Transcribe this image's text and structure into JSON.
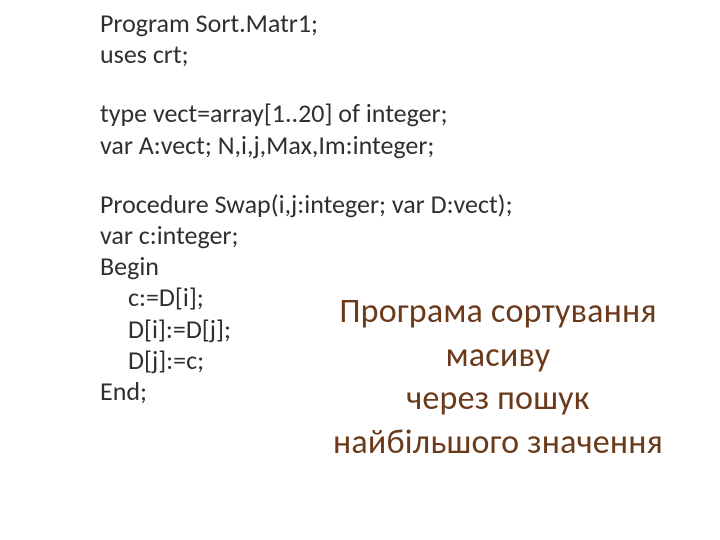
{
  "code": {
    "l1": "Program Sort.Matr1;",
    "l2": "uses crt;",
    "l3": "type vect=array[1..20] of integer;",
    "l4": "var A:vect;  N,i,j,Max,Im:integer;",
    "l5": "Procedure Swap(i,j:integer; var D:vect);",
    "l6": "var c:integer;",
    "l7": "Begin",
    "l8": "c:=D[i];",
    "l9": "D[i]:=D[j];",
    "l10": "D[j]:=c;",
    "l11": "End;"
  },
  "title": {
    "line1": "Програма сортування",
    "line2": "масиву",
    "line3": "через пошук",
    "line4": "найбільшого значення"
  }
}
